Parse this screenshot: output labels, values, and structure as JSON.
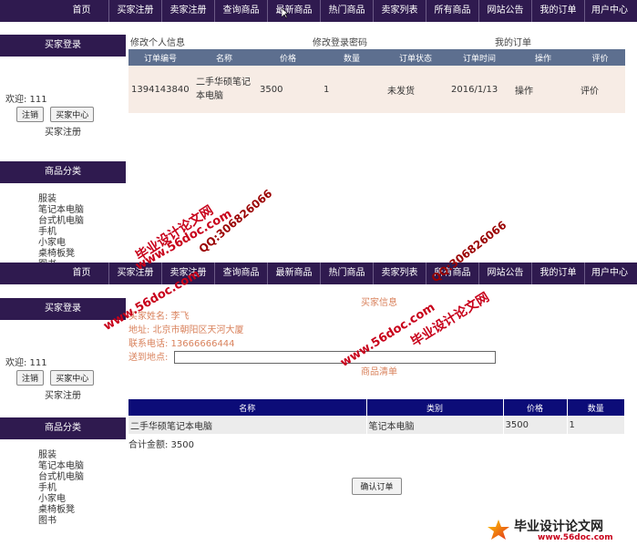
{
  "nav": [
    "首页",
    "买家注册",
    "卖家注册",
    "查询商品",
    "最新商品",
    "热门商品",
    "卖家列表",
    "所有商品",
    "网站公告",
    "我的订单",
    "用户中心"
  ],
  "sidebar": {
    "login_title": "买家登录",
    "welcome": "欢迎: 111",
    "logout_btn": "注销",
    "buyer_center_btn": "买家中心",
    "register_link": "买家注册",
    "category_title": "商品分类",
    "categories": [
      "服装",
      "笔记本电脑",
      "台式机电脑",
      "手机",
      "小家电",
      "桌椅板凳",
      "图书"
    ]
  },
  "top_panel": {
    "tabs": [
      "修改个人信息",
      "修改登录密码",
      "我的订单"
    ],
    "table_headers": [
      "订单编号",
      "名称",
      "价格",
      "数量",
      "订单状态",
      "订单时间",
      "操作",
      "评价"
    ],
    "row": {
      "order_no": "1394143840",
      "name": "二手华硕笔记本电脑",
      "price": "3500",
      "qty": "1",
      "status": "未发货",
      "time": "2016/1/13",
      "action": "操作",
      "review": "评价"
    }
  },
  "bottom_panel": {
    "buyer_info_title": "买家信息",
    "buyer_name": "买家姓名: 李飞",
    "address": "地址: 北京市朝阳区天河大厦",
    "phone": "联系电话: 13666666444",
    "delivery_label": "送到地点:",
    "delivery_value": "",
    "cart_title": "商品清单",
    "cart_headers": [
      "名称",
      "类别",
      "价格",
      "数量"
    ],
    "cart_row": {
      "name": "二手华硕笔记本电脑",
      "category": "笔记本电脑",
      "price": "3500",
      "qty": "1"
    },
    "total": "合计金额: 3500",
    "confirm_btn": "确认订单"
  },
  "watermarks": {
    "site": "www.56doc.com",
    "qq": "QQ:306826066",
    "brand": "毕业设计论文网"
  },
  "logo": {
    "brand": "毕业设计论文网",
    "url": "www.56doc.com"
  }
}
